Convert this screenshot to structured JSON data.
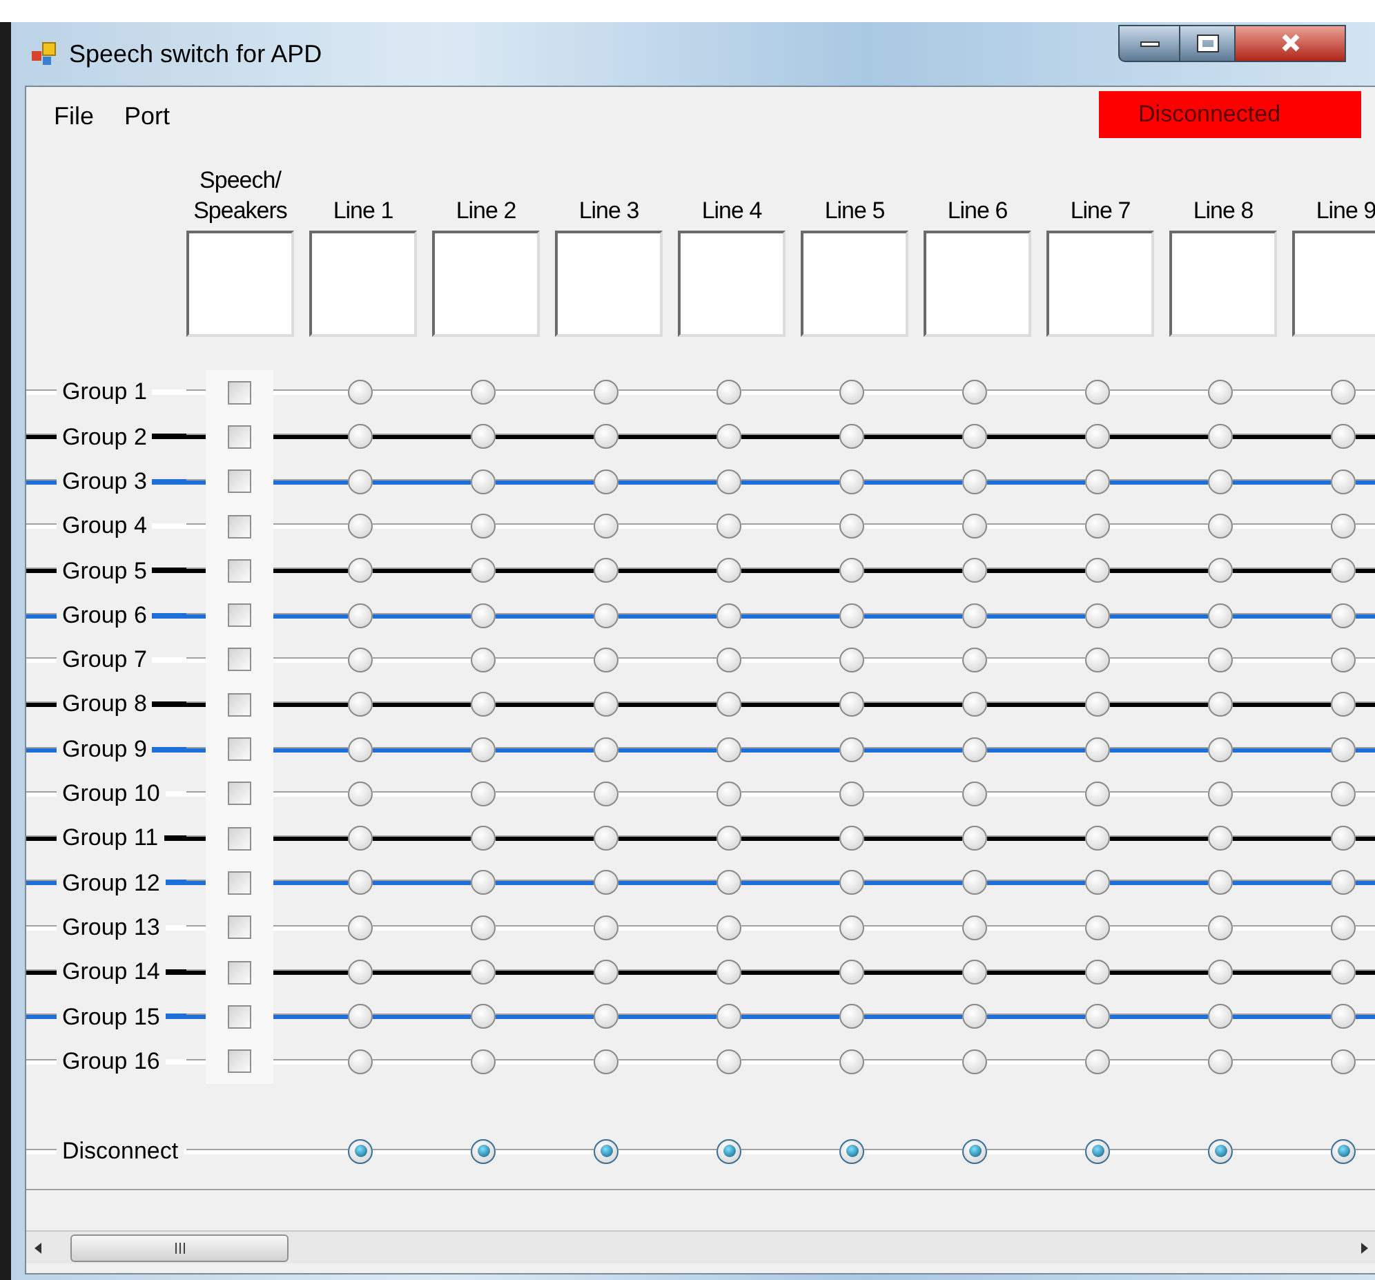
{
  "window": {
    "title": "Speech switch for APD"
  },
  "menu": [
    {
      "label": "File"
    },
    {
      "label": "Port"
    }
  ],
  "status": "Disconnected",
  "columns": [
    {
      "label": "Speech/ Speakers"
    },
    {
      "label": "Line 1"
    },
    {
      "label": "Line 2"
    },
    {
      "label": "Line 3"
    },
    {
      "label": "Line 4"
    },
    {
      "label": "Line 5"
    },
    {
      "label": "Line 6"
    },
    {
      "label": "Line 7"
    },
    {
      "label": "Line 8"
    },
    {
      "label": "Line 9"
    }
  ],
  "groups": [
    {
      "label": "Group 1",
      "color": "#ffffff",
      "checked": false,
      "radios": [
        {
          "selected": false
        },
        {
          "selected": false
        },
        {
          "selected": false
        },
        {
          "selected": false
        },
        {
          "selected": false
        },
        {
          "selected": false
        },
        {
          "selected": false
        },
        {
          "selected": false
        },
        {
          "selected": false
        }
      ]
    },
    {
      "label": "Group 2",
      "color": "#000000",
      "checked": false,
      "radios": [
        {
          "selected": false
        },
        {
          "selected": false
        },
        {
          "selected": false
        },
        {
          "selected": false
        },
        {
          "selected": false
        },
        {
          "selected": false
        },
        {
          "selected": false
        },
        {
          "selected": false
        },
        {
          "selected": false
        }
      ]
    },
    {
      "label": "Group 3",
      "color": "#1e6fd9",
      "checked": false,
      "radios": [
        {
          "selected": false
        },
        {
          "selected": false
        },
        {
          "selected": false
        },
        {
          "selected": false
        },
        {
          "selected": false
        },
        {
          "selected": false
        },
        {
          "selected": false
        },
        {
          "selected": false
        },
        {
          "selected": false
        }
      ]
    },
    {
      "label": "Group 4",
      "color": "#ffffff",
      "checked": false,
      "radios": [
        {
          "selected": false
        },
        {
          "selected": false
        },
        {
          "selected": false
        },
        {
          "selected": false
        },
        {
          "selected": false
        },
        {
          "selected": false
        },
        {
          "selected": false
        },
        {
          "selected": false
        },
        {
          "selected": false
        }
      ]
    },
    {
      "label": "Group 5",
      "color": "#000000",
      "checked": false,
      "radios": [
        {
          "selected": false
        },
        {
          "selected": false
        },
        {
          "selected": false
        },
        {
          "selected": false
        },
        {
          "selected": false
        },
        {
          "selected": false
        },
        {
          "selected": false
        },
        {
          "selected": false
        },
        {
          "selected": false
        }
      ]
    },
    {
      "label": "Group 6",
      "color": "#1e6fd9",
      "checked": false,
      "radios": [
        {
          "selected": false
        },
        {
          "selected": false
        },
        {
          "selected": false
        },
        {
          "selected": false
        },
        {
          "selected": false
        },
        {
          "selected": false
        },
        {
          "selected": false
        },
        {
          "selected": false
        },
        {
          "selected": false
        }
      ]
    },
    {
      "label": "Group 7",
      "color": "#ffffff",
      "checked": false,
      "radios": [
        {
          "selected": false
        },
        {
          "selected": false
        },
        {
          "selected": false
        },
        {
          "selected": false
        },
        {
          "selected": false
        },
        {
          "selected": false
        },
        {
          "selected": false
        },
        {
          "selected": false
        },
        {
          "selected": false
        }
      ]
    },
    {
      "label": "Group 8",
      "color": "#000000",
      "checked": false,
      "radios": [
        {
          "selected": false
        },
        {
          "selected": false
        },
        {
          "selected": false
        },
        {
          "selected": false
        },
        {
          "selected": false
        },
        {
          "selected": false
        },
        {
          "selected": false
        },
        {
          "selected": false
        },
        {
          "selected": false
        }
      ]
    },
    {
      "label": "Group 9",
      "color": "#1e6fd9",
      "checked": false,
      "radios": [
        {
          "selected": false
        },
        {
          "selected": false
        },
        {
          "selected": false
        },
        {
          "selected": false
        },
        {
          "selected": false
        },
        {
          "selected": false
        },
        {
          "selected": false
        },
        {
          "selected": false
        },
        {
          "selected": false
        }
      ]
    },
    {
      "label": "Group 10",
      "color": "#ffffff",
      "checked": false,
      "radios": [
        {
          "selected": false
        },
        {
          "selected": false
        },
        {
          "selected": false
        },
        {
          "selected": false
        },
        {
          "selected": false
        },
        {
          "selected": false
        },
        {
          "selected": false
        },
        {
          "selected": false
        },
        {
          "selected": false
        }
      ]
    },
    {
      "label": "Group 11",
      "color": "#000000",
      "checked": false,
      "radios": [
        {
          "selected": false
        },
        {
          "selected": false
        },
        {
          "selected": false
        },
        {
          "selected": false
        },
        {
          "selected": false
        },
        {
          "selected": false
        },
        {
          "selected": false
        },
        {
          "selected": false
        },
        {
          "selected": false
        }
      ]
    },
    {
      "label": "Group 12",
      "color": "#1e6fd9",
      "checked": false,
      "radios": [
        {
          "selected": false
        },
        {
          "selected": false
        },
        {
          "selected": false
        },
        {
          "selected": false
        },
        {
          "selected": false
        },
        {
          "selected": false
        },
        {
          "selected": false
        },
        {
          "selected": false
        },
        {
          "selected": false
        }
      ]
    },
    {
      "label": "Group 13",
      "color": "#ffffff",
      "checked": false,
      "radios": [
        {
          "selected": false
        },
        {
          "selected": false
        },
        {
          "selected": false
        },
        {
          "selected": false
        },
        {
          "selected": false
        },
        {
          "selected": false
        },
        {
          "selected": false
        },
        {
          "selected": false
        },
        {
          "selected": false
        }
      ]
    },
    {
      "label": "Group 14",
      "color": "#000000",
      "checked": false,
      "radios": [
        {
          "selected": false
        },
        {
          "selected": false
        },
        {
          "selected": false
        },
        {
          "selected": false
        },
        {
          "selected": false
        },
        {
          "selected": false
        },
        {
          "selected": false
        },
        {
          "selected": false
        },
        {
          "selected": false
        }
      ]
    },
    {
      "label": "Group 15",
      "color": "#1e6fd9",
      "checked": false,
      "radios": [
        {
          "selected": false
        },
        {
          "selected": false
        },
        {
          "selected": false
        },
        {
          "selected": false
        },
        {
          "selected": false
        },
        {
          "selected": false
        },
        {
          "selected": false
        },
        {
          "selected": false
        },
        {
          "selected": false
        }
      ]
    },
    {
      "label": "Group 16",
      "color": "#ffffff",
      "checked": false,
      "radios": [
        {
          "selected": false
        },
        {
          "selected": false
        },
        {
          "selected": false
        },
        {
          "selected": false
        },
        {
          "selected": false
        },
        {
          "selected": false
        },
        {
          "selected": false
        },
        {
          "selected": false
        },
        {
          "selected": false
        }
      ]
    }
  ],
  "disconnect": {
    "label": "Disconnect",
    "color": "#ffffff",
    "radios": [
      {
        "selected": true
      },
      {
        "selected": true
      },
      {
        "selected": true
      },
      {
        "selected": true
      },
      {
        "selected": true
      },
      {
        "selected": true
      },
      {
        "selected": true
      },
      {
        "selected": true
      },
      {
        "selected": true
      }
    ]
  }
}
